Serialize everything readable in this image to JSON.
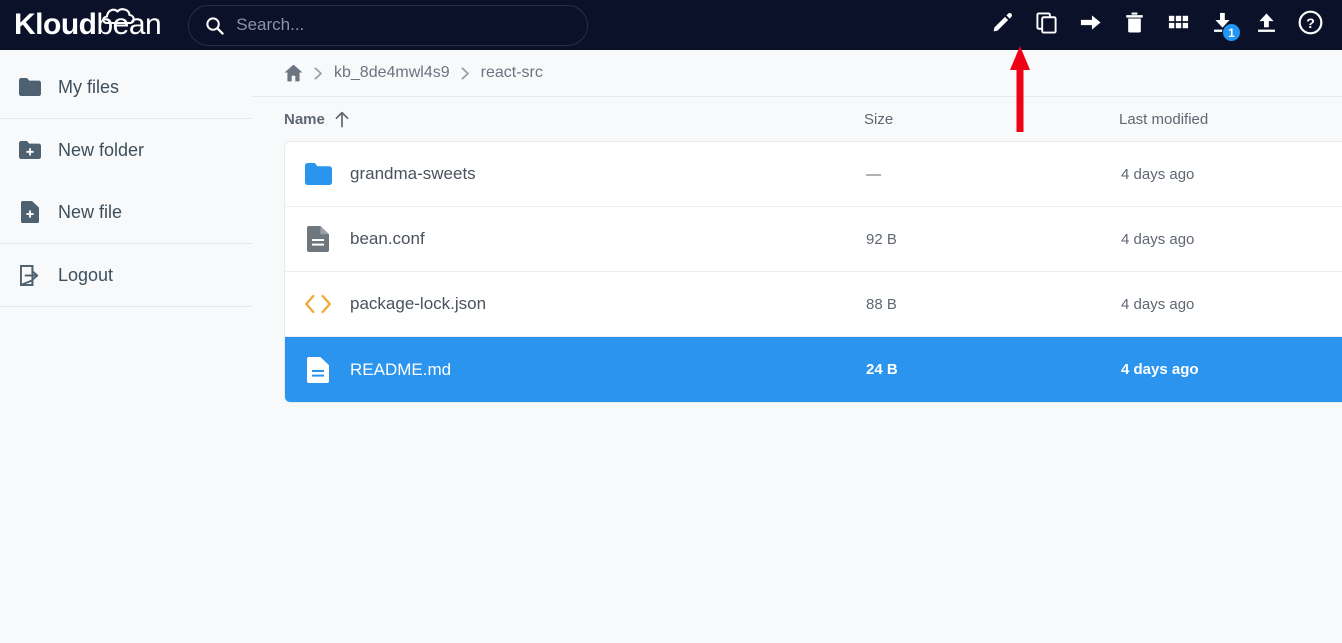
{
  "brand": {
    "name_bold": "Kloud",
    "name_light": "bean",
    "logo_icon": "cloud-icon"
  },
  "search": {
    "placeholder": "Search...",
    "value": "",
    "icon": "search-icon"
  },
  "toolbar": {
    "actions": [
      {
        "name": "edit",
        "icon": "pencil-icon",
        "label": "Edit"
      },
      {
        "name": "copy",
        "icon": "copy-icon",
        "label": "Copy"
      },
      {
        "name": "move",
        "icon": "arrow-right-icon",
        "label": "Move"
      },
      {
        "name": "delete",
        "icon": "trash-icon",
        "label": "Delete"
      },
      {
        "name": "apps",
        "icon": "grid-icon",
        "label": "Apps"
      },
      {
        "name": "download",
        "icon": "download-icon",
        "label": "Download",
        "badge": "1"
      },
      {
        "name": "upload",
        "icon": "upload-icon",
        "label": "Upload"
      },
      {
        "name": "help",
        "icon": "question-mark-icon",
        "label": "Help"
      }
    ]
  },
  "annotation": {
    "type": "arrow-up",
    "color": "#f00014",
    "points_at": "edit"
  },
  "sidebar": {
    "items": [
      {
        "label": "My files",
        "icon": "folder-icon"
      },
      {
        "label": "New folder",
        "icon": "folder-plus-icon"
      },
      {
        "label": "New file",
        "icon": "file-plus-icon"
      },
      {
        "label": "Logout",
        "icon": "logout-icon"
      }
    ]
  },
  "breadcrumb": {
    "home_icon": "home-icon",
    "separator": "›",
    "crumbs": [
      "kb_8de4mwl4s9",
      "react-src"
    ]
  },
  "table": {
    "columns": {
      "name": "Name",
      "size": "Size",
      "modified": "Last modified"
    },
    "sort": {
      "column": "Name",
      "direction": "asc",
      "icon": "arrow-up-icon"
    },
    "rows": [
      {
        "name": "grandma-sweets",
        "size": "—",
        "modified": "4 days ago",
        "icon": "folder-icon",
        "kind": "folder",
        "selected": false
      },
      {
        "name": "bean.conf",
        "size": "92 B",
        "modified": "4 days ago",
        "icon": "document-icon",
        "kind": "file",
        "selected": false
      },
      {
        "name": "package-lock.json",
        "size": "88 B",
        "modified": "4 days ago",
        "icon": "code-icon",
        "kind": "code",
        "selected": false
      },
      {
        "name": "README.md",
        "size": "24 B",
        "modified": "4 days ago",
        "icon": "document-icon",
        "kind": "file",
        "selected": true
      }
    ]
  },
  "colors": {
    "topbar_bg": "#0a1128",
    "page_bg": "#f8f9fa",
    "accent_blue": "#2b94ef",
    "folder_blue": "#2b94ef",
    "code_orange": "#f2a93b",
    "file_gray": "#6e767e",
    "annotation_red": "#f00014"
  }
}
